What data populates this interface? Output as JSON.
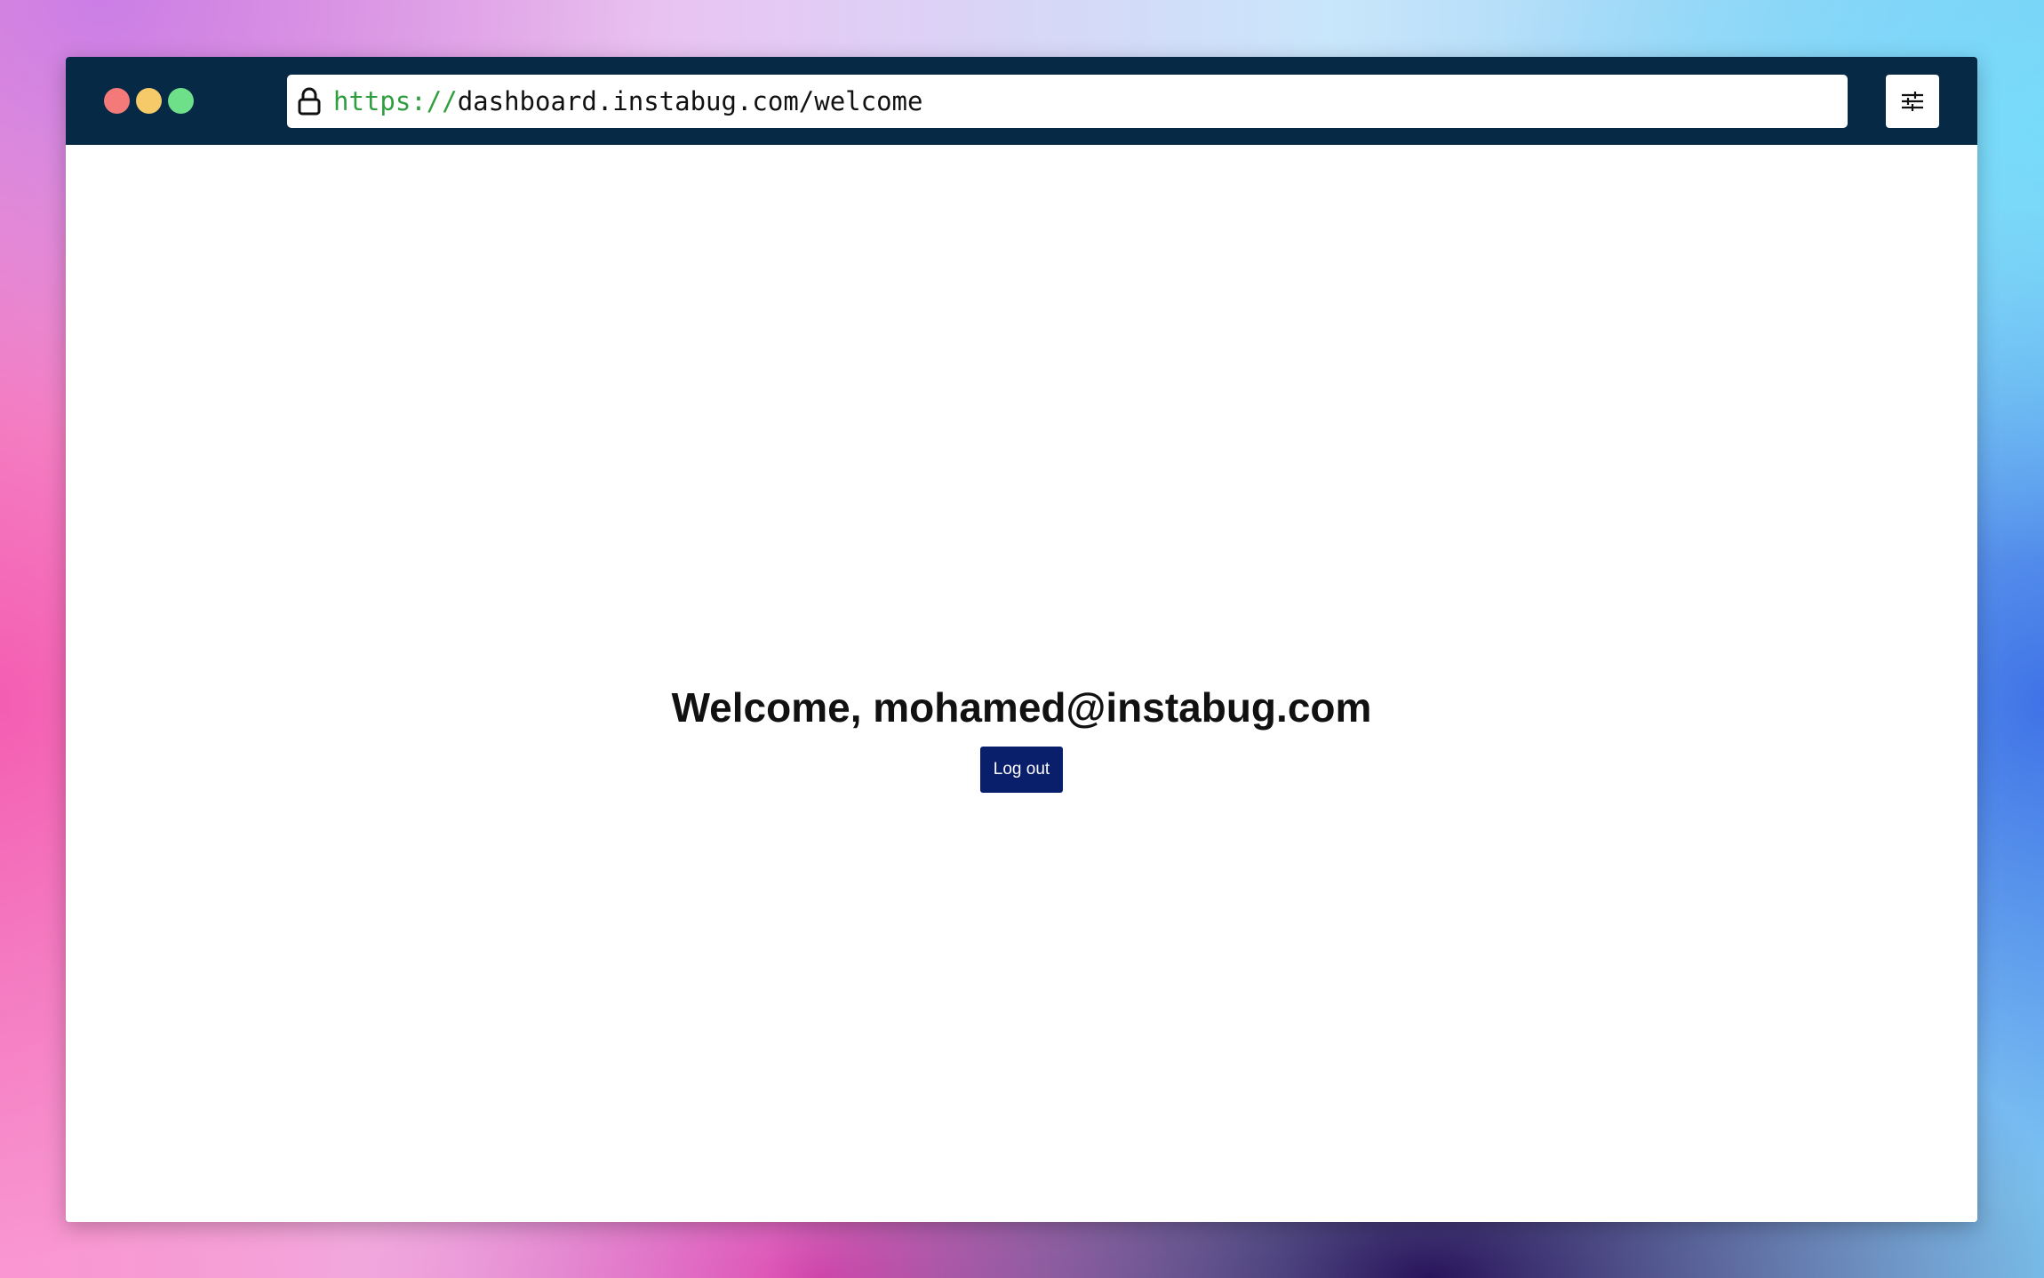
{
  "browser": {
    "url_scheme": "https://",
    "url_rest": "dashboard.instabug.com/welcome",
    "icons": {
      "lock": "lock-icon",
      "settings": "sliders-icon"
    },
    "traffic_light_colors": [
      "#f47a7a",
      "#f6c969",
      "#6ee08a"
    ],
    "toolbar_color": "#062a45"
  },
  "page": {
    "welcome_text": "Welcome, mohamed@instabug.com",
    "logout_label": "Log out",
    "logout_color": "#0a1f6b"
  }
}
